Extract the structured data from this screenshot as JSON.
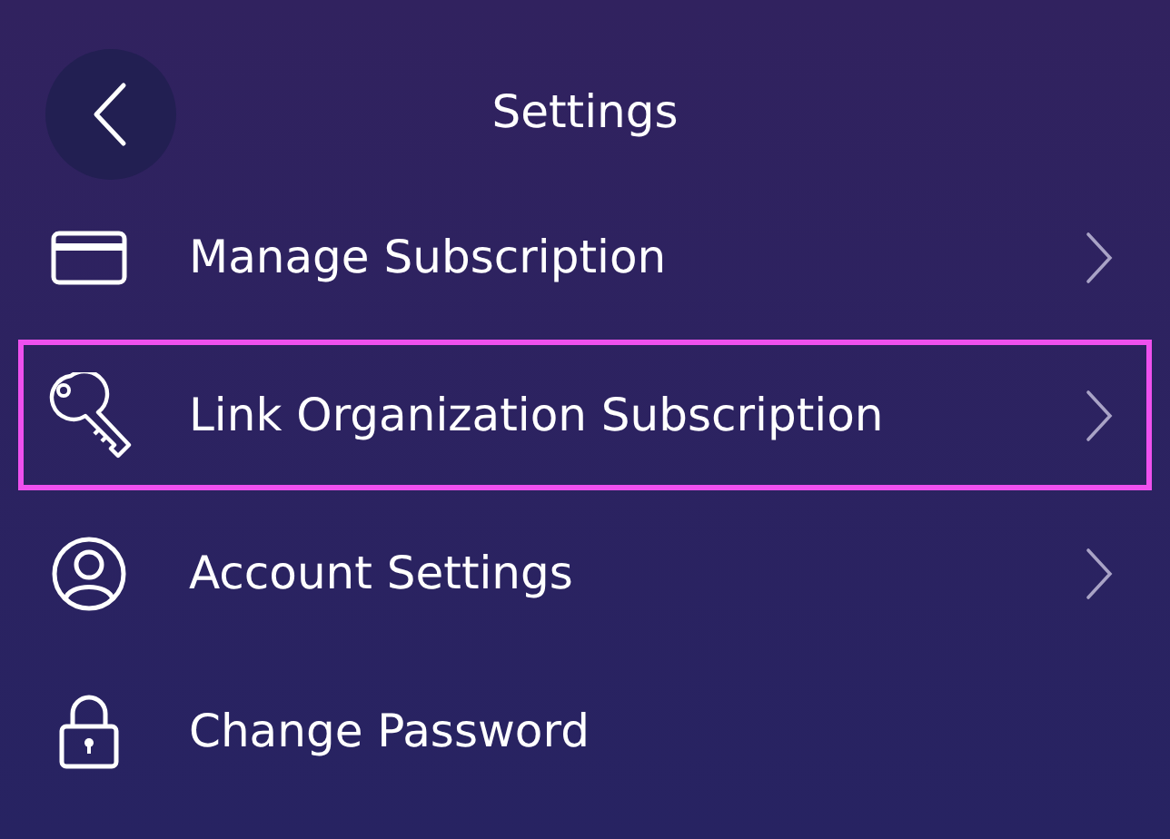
{
  "header": {
    "title": "Settings",
    "back_button": true
  },
  "items": [
    {
      "label": "Manage Subscription",
      "kind": "card",
      "chevron": true,
      "highlighted": false
    },
    {
      "label": "Link Organization Subscription",
      "kind": "key",
      "chevron": true,
      "highlighted": true
    },
    {
      "label": "Account Settings",
      "kind": "person",
      "chevron": true,
      "highlighted": false
    },
    {
      "label": "Change Password",
      "kind": "lock",
      "chevron": false,
      "highlighted": false
    }
  ]
}
